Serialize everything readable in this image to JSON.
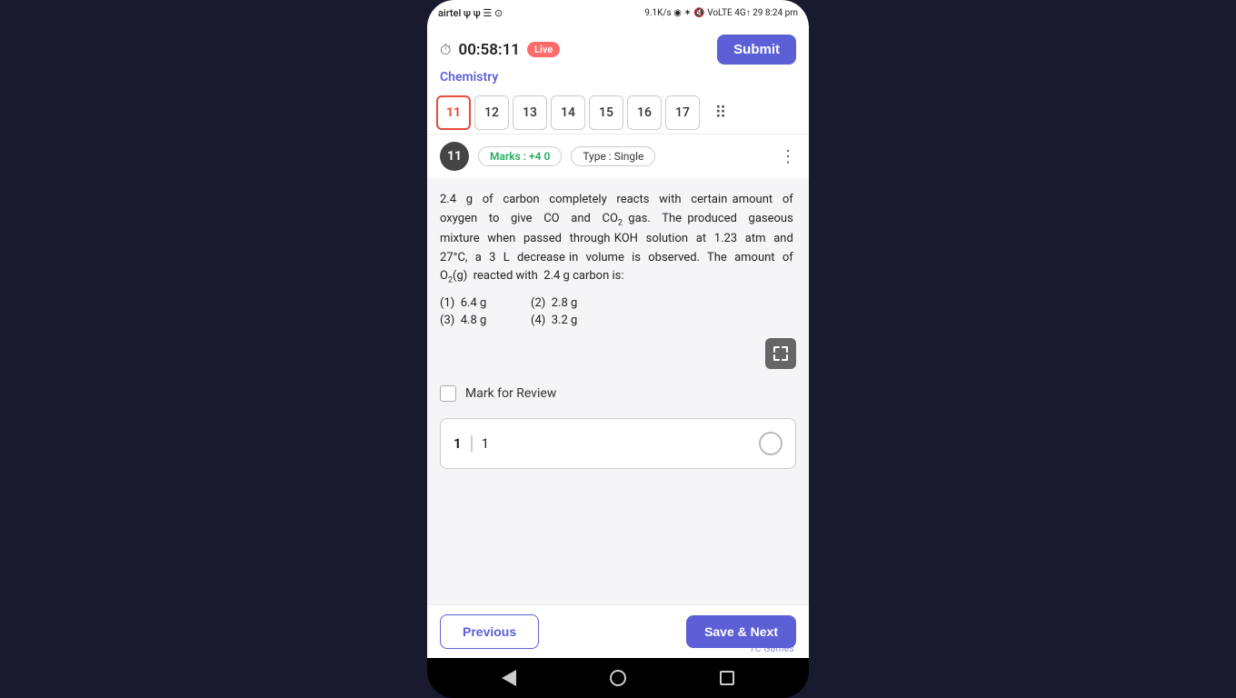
{
  "statusBar": {
    "left": "airtel ψ ψ ☰ ⊙",
    "center": "9.1K/s ◉ ✶ 🔇 VoLTE 4G↑ 29 8:24 pm"
  },
  "header": {
    "timer": "00:58:11",
    "liveBadge": "Live",
    "submitLabel": "Submit",
    "subjectLabel": "Chemistry"
  },
  "questionNav": {
    "items": [
      "11",
      "12",
      "13",
      "14",
      "15",
      "16",
      "17"
    ],
    "activeIndex": 0
  },
  "questionHeader": {
    "number": "11",
    "marksLabel": "Marks :",
    "marksPositive": "+4",
    "marksNegative": "0",
    "typeLabel": "Type :",
    "typeValue": "Single"
  },
  "questionBody": {
    "text1": "2.4  g  of  carbon  completely  reacts  with  certain amount  of  oxygen  to  give  CO  and  CO",
    "co2sub": "2",
    "text2": " gas.  The produced  gaseous  mixture  when  passed  through KOH  solution  at  1.23  atm  and  27°C,  a  3  L  decrease in  volume  is  observed.  The  amount  of  O",
    "o2sub": "2",
    "text3": "(g)  reacted with  2.4 g carbon is:",
    "options": [
      {
        "num": "(1)",
        "val": "6.4 g",
        "num2": "(2)",
        "val2": "2.8 g"
      },
      {
        "num": "(3)",
        "val": "4.8 g",
        "num2": "(4)",
        "val2": "3.2 g"
      }
    ]
  },
  "markForReview": {
    "label": "Mark for Review"
  },
  "answerInput": {
    "label": "1",
    "value": "1"
  },
  "buttons": {
    "previous": "Previous",
    "saveNext": "Save & Next"
  },
  "watermark": "TC Games",
  "navBar": {
    "square": "□",
    "circle": "○",
    "triangle": "◁"
  }
}
